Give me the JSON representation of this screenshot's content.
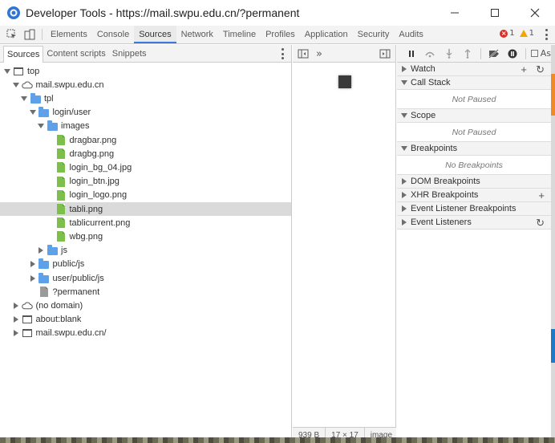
{
  "window": {
    "title": "Developer Tools - https://mail.swpu.edu.cn/?permanent"
  },
  "main_tabs": [
    {
      "label": "Elements"
    },
    {
      "label": "Console"
    },
    {
      "label": "Sources",
      "active": true
    },
    {
      "label": "Network"
    },
    {
      "label": "Timeline"
    },
    {
      "label": "Profiles"
    },
    {
      "label": "Application"
    },
    {
      "label": "Security"
    },
    {
      "label": "Audits"
    }
  ],
  "status": {
    "errors": "1",
    "warnings": "1"
  },
  "navigator": {
    "tabs": [
      {
        "label": "Sources",
        "active": true
      },
      {
        "label": "Content scripts"
      },
      {
        "label": "Snippets"
      }
    ],
    "tree": [
      {
        "label": "top",
        "icon": "frame-icon",
        "arrow": "down",
        "level": 0
      },
      {
        "label": "mail.swpu.edu.cn",
        "icon": "cloud-icon",
        "arrow": "down",
        "level": 1
      },
      {
        "label": "tpl",
        "icon": "folder-icon",
        "arrow": "down",
        "level": 2
      },
      {
        "label": "login/user",
        "icon": "folder-icon",
        "arrow": "down",
        "level": 3
      },
      {
        "label": "images",
        "icon": "folder-icon",
        "arrow": "down",
        "level": 4
      },
      {
        "label": "dragbar.png",
        "icon": "image-file-icon",
        "arrow": "none",
        "level": 5
      },
      {
        "label": "dragbg.png",
        "icon": "image-file-icon",
        "arrow": "none",
        "level": 5
      },
      {
        "label": "login_bg_04.jpg",
        "icon": "image-file-icon",
        "arrow": "none",
        "level": 5
      },
      {
        "label": "login_btn.jpg",
        "icon": "image-file-icon",
        "arrow": "none",
        "level": 5
      },
      {
        "label": "login_logo.png",
        "icon": "image-file-icon",
        "arrow": "none",
        "level": 5
      },
      {
        "label": "tabli.png",
        "icon": "image-file-icon",
        "arrow": "none",
        "level": 5,
        "selected": true
      },
      {
        "label": "tablicurrent.png",
        "icon": "image-file-icon",
        "arrow": "none",
        "level": 5
      },
      {
        "label": "wbg.png",
        "icon": "image-file-icon",
        "arrow": "none",
        "level": 5
      },
      {
        "label": "js",
        "icon": "folder-icon",
        "arrow": "right",
        "level": 4
      },
      {
        "label": "public/js",
        "icon": "folder-icon",
        "arrow": "right",
        "level": 3
      },
      {
        "label": "user/public/js",
        "icon": "folder-icon",
        "arrow": "right",
        "level": 3
      },
      {
        "label": "?permanent",
        "icon": "document-file-icon",
        "arrow": "none",
        "level": 3
      },
      {
        "label": "(no domain)",
        "icon": "cloud-icon",
        "arrow": "right",
        "level": 1
      },
      {
        "label": "about:blank",
        "icon": "frame-icon",
        "arrow": "right",
        "level": 1
      },
      {
        "label": "mail.swpu.edu.cn/",
        "icon": "frame-icon",
        "arrow": "right",
        "level": 1
      }
    ]
  },
  "editor": {
    "footer": {
      "size": "939 B",
      "dimensions": "17 × 17",
      "mime": "image"
    }
  },
  "debugger": {
    "sections": [
      {
        "label": "Watch",
        "arrow": "right",
        "action": "+",
        "action2": "↻"
      },
      {
        "label": "Call Stack",
        "arrow": "down",
        "body": "Not Paused"
      },
      {
        "label": "Scope",
        "arrow": "down",
        "body": "Not Paused"
      },
      {
        "label": "Breakpoints",
        "arrow": "down",
        "body": "No Breakpoints"
      },
      {
        "label": "DOM Breakpoints",
        "arrow": "right"
      },
      {
        "label": "XHR Breakpoints",
        "arrow": "right",
        "action": "+"
      },
      {
        "label": "Event Listener Breakpoints",
        "arrow": "right"
      },
      {
        "label": "Event Listeners",
        "arrow": "right",
        "action": "↻"
      }
    ],
    "async_label": "As"
  },
  "colors": {
    "accent": "#3879d9",
    "folder": "#5fa1e8",
    "image_file": "#7cbf4a",
    "error": "#d93025",
    "warning": "#f2a600"
  }
}
